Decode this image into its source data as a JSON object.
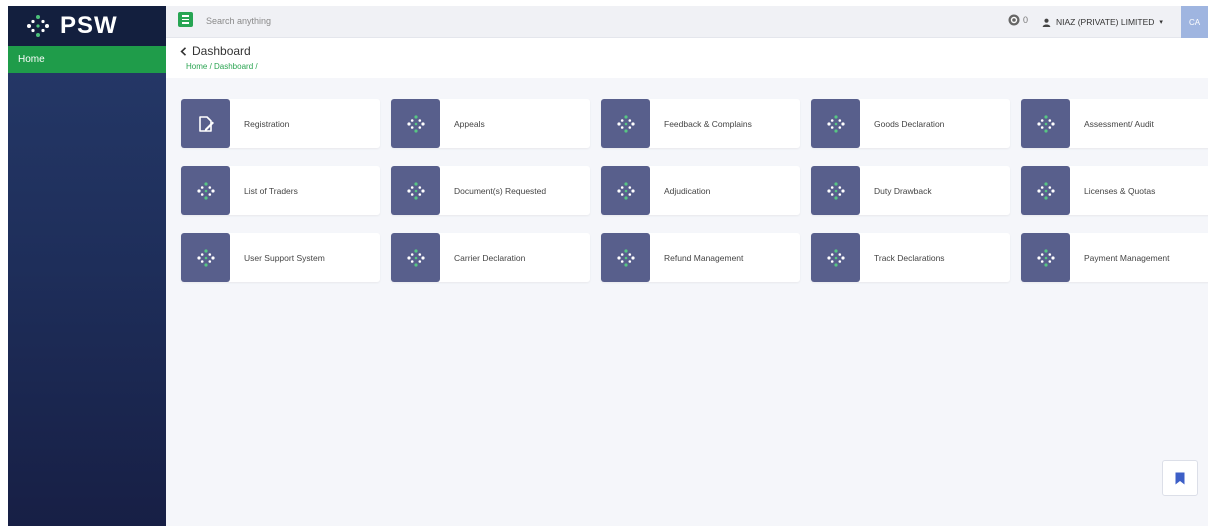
{
  "brand": {
    "name": "PSW"
  },
  "sidebar": {
    "items": [
      {
        "label": "Home",
        "active": true
      }
    ]
  },
  "topbar": {
    "search_placeholder": "Search anything",
    "notification_count": "0",
    "user_name": "NIAZ (PRIVATE) LIMITED",
    "caret": "▾",
    "avatar_initials": "CA"
  },
  "page": {
    "back_glyph": "‹",
    "title": "Dashboard",
    "breadcrumb": "Home / Dashboard /"
  },
  "tiles": [
    {
      "label": "Registration",
      "icon": "registration-icon"
    },
    {
      "label": "Appeals",
      "icon": "psw-icon"
    },
    {
      "label": "Feedback & Complains",
      "icon": "psw-icon"
    },
    {
      "label": "Goods Declaration",
      "icon": "psw-icon"
    },
    {
      "label": "Assessment/ Audit",
      "icon": "psw-icon"
    },
    {
      "label": "List of Traders",
      "icon": "psw-icon"
    },
    {
      "label": "Document(s) Requested",
      "icon": "psw-icon"
    },
    {
      "label": "Adjudication",
      "icon": "psw-icon"
    },
    {
      "label": "Duty Drawback",
      "icon": "psw-icon"
    },
    {
      "label": "Licenses & Quotas",
      "icon": "psw-icon"
    },
    {
      "label": "User Support System",
      "icon": "psw-icon"
    },
    {
      "label": "Carrier Declaration",
      "icon": "psw-icon"
    },
    {
      "label": "Refund Management",
      "icon": "psw-icon"
    },
    {
      "label": "Track Declarations",
      "icon": "psw-icon"
    },
    {
      "label": "Payment Management",
      "icon": "psw-icon"
    }
  ],
  "colors": {
    "sidebar": "#1e2e5a",
    "accent_green": "#27a553",
    "tile_icon_bg": "#585f8c",
    "avatar_bg": "#9fb5e0"
  }
}
